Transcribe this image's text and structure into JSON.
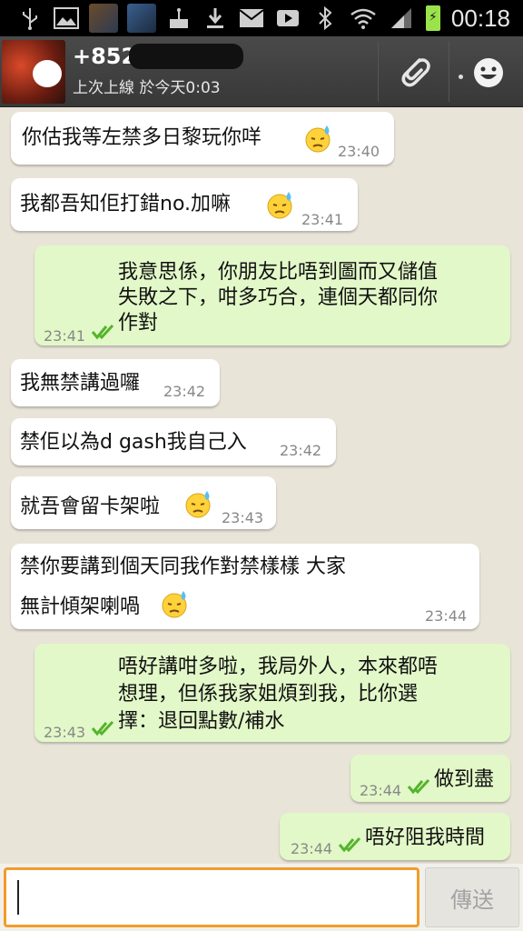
{
  "status_bar": {
    "time": "00:18",
    "icons": [
      "usb-icon",
      "image-icon",
      "game-thumbnail-1",
      "game-thumbnail-2",
      "cake-icon",
      "download-icon",
      "mail-icon",
      "play-icon",
      "bluetooth-icon",
      "wifi-icon",
      "signal-icon",
      "battery-charging-icon"
    ]
  },
  "header": {
    "contact_name": "+852",
    "last_seen": "上次上線 於今天0:03",
    "icons": [
      "back-icon",
      "attach-icon",
      "overflow-menu-icon",
      "emoji-icon"
    ]
  },
  "messages": [
    {
      "dir": "in",
      "lines": [
        "你估我等左禁多日黎玩你咩"
      ],
      "emoji": "sweat-emoji",
      "time": "23:40"
    },
    {
      "dir": "in",
      "lines": [
        "我都吾知佢打錯no.加嘛"
      ],
      "emoji": "sweat-emoji",
      "time": "23:41"
    },
    {
      "dir": "out",
      "lines": [
        "我意思係，你朋友比唔到圖而又儲值",
        "失敗之下，咁多巧合，連個天都同你",
        "作對"
      ],
      "time": "23:41",
      "status": "read"
    },
    {
      "dir": "in",
      "lines": [
        "我無禁講過囉"
      ],
      "time": "23:42"
    },
    {
      "dir": "in",
      "lines": [
        "禁佢以為d gash我自己入"
      ],
      "time": "23:42"
    },
    {
      "dir": "in",
      "lines": [
        "就吾會留卡架啦"
      ],
      "emoji": "sweat-emoji",
      "time": "23:43"
    },
    {
      "dir": "in",
      "lines": [
        "禁你要講到個天同我作對禁樣樣 大家",
        "無計傾架喇喎"
      ],
      "emoji": "sweat-emoji",
      "time": "23:44"
    },
    {
      "dir": "out",
      "lines": [
        "唔好講咁多啦，我局外人，本來都唔",
        "想理，但係我家姐煩到我，比你選",
        "擇：退回點數/補水"
      ],
      "time": "23:43",
      "status": "read"
    },
    {
      "dir": "out",
      "lines": [
        "做到盡"
      ],
      "time": "23:44",
      "status": "read"
    },
    {
      "dir": "out",
      "lines": [
        "唔好阻我時間"
      ],
      "time": "23:44",
      "status": "read"
    }
  ],
  "input": {
    "value": "",
    "send_label": "傳送"
  },
  "colors": {
    "incoming_bubble": "#ffffff",
    "outgoing_bubble": "#e2f8c8",
    "read_check": "#55b42d",
    "input_focus": "#f39c2a"
  }
}
